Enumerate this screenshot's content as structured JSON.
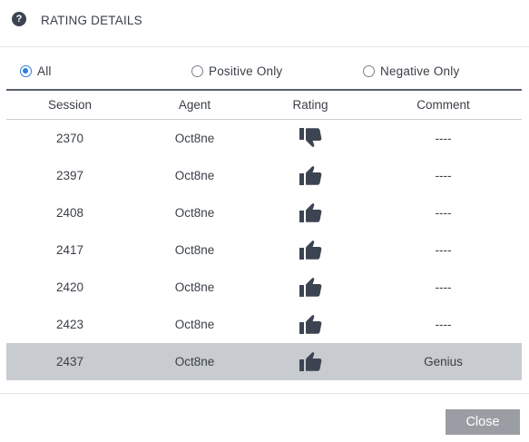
{
  "header": {
    "title": "RATING DETAILS",
    "icon": "question-circle-icon"
  },
  "filters": {
    "selected": "all",
    "options": [
      {
        "id": "all",
        "label": "All"
      },
      {
        "id": "positive",
        "label": "Positive Only"
      },
      {
        "id": "negative",
        "label": "Negative Only"
      }
    ]
  },
  "table": {
    "columns": [
      "Session",
      "Agent",
      "Rating",
      "Comment"
    ],
    "rows": [
      {
        "session": "2370",
        "agent": "Oct8ne",
        "rating": "thumbs-down",
        "comment": "----"
      },
      {
        "session": "2397",
        "agent": "Oct8ne",
        "rating": "thumbs-up",
        "comment": "----"
      },
      {
        "session": "2408",
        "agent": "Oct8ne",
        "rating": "thumbs-up",
        "comment": "----"
      },
      {
        "session": "2417",
        "agent": "Oct8ne",
        "rating": "thumbs-up",
        "comment": "----"
      },
      {
        "session": "2420",
        "agent": "Oct8ne",
        "rating": "thumbs-up",
        "comment": "----"
      },
      {
        "session": "2423",
        "agent": "Oct8ne",
        "rating": "thumbs-up",
        "comment": "----"
      },
      {
        "session": "2437",
        "agent": "Oct8ne",
        "rating": "thumbs-up",
        "comment": "Genius",
        "selected": true
      }
    ]
  },
  "footer": {
    "close_label": "Close"
  },
  "colors": {
    "accent": "#2f7de1",
    "icon": "#3d4451",
    "selected_row": "#c8cbcf",
    "button": "#9a9da3"
  }
}
